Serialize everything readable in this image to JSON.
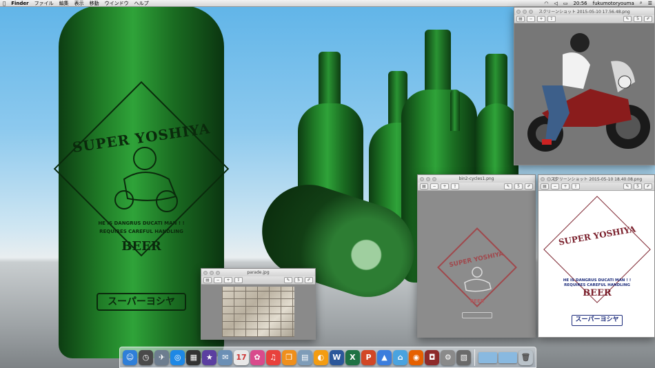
{
  "menubar": {
    "app_name": "Finder",
    "menus": [
      "ファイル",
      "編集",
      "表示",
      "移動",
      "ウインドウ",
      "ヘルプ"
    ],
    "clock": "20:56",
    "user": "fukumotoryouma"
  },
  "wallpaper": {
    "label_brand": "SUPER YOSHIYA",
    "label_line1": "HE IS DANGRUS DUCATI MAN ! !",
    "label_line2": "REQUIRES CAREFUL HANDLING",
    "label_beer": "BEER",
    "label_kana": "スーパーヨシヤ"
  },
  "windows": {
    "parade": {
      "title": "parade.jpg",
      "share_label": "5"
    },
    "screenshot1": {
      "title": "スクリーンショット 2015-05-10 17.56.48.png",
      "share_label": "5"
    },
    "bin2": {
      "title": "bin2-cycles1.png",
      "share_label": "5",
      "art_brand": "SUPER YOSHIYA",
      "art_beer": "BEER"
    },
    "screenshot2": {
      "title": "スクリーンショット 2015-05-10 18.40.08.png",
      "share_label": "5",
      "brand": "SUPER YOSHIYA",
      "line1": "HE IS DANGRUS DUCATI MAN ! !",
      "line2": "REQUIRES CAREFUL HANDLING",
      "beer": "BEER",
      "kana": "スーパーヨシヤ"
    }
  },
  "toolbar_icons": [
    "sidebar-toggle",
    "zoom-out",
    "zoom-in",
    "share",
    "markup",
    "rotate",
    "annotate"
  ],
  "dock": {
    "apps": [
      {
        "name": "finder",
        "glyph": "☺",
        "color": "#2f7fd8"
      },
      {
        "name": "dashboard",
        "glyph": "◷",
        "color": "#4a4a4a"
      },
      {
        "name": "launchpad",
        "glyph": "✈",
        "color": "#6d7d8f"
      },
      {
        "name": "safari",
        "glyph": "◎",
        "color": "#1e88e5"
      },
      {
        "name": "mission-control",
        "glyph": "▦",
        "color": "#333"
      },
      {
        "name": "imovie",
        "glyph": "★",
        "color": "#5b3fa0"
      },
      {
        "name": "mail",
        "glyph": "✉",
        "color": "#6b8fb5"
      },
      {
        "name": "calendar",
        "glyph": "17",
        "color": "#e8e8e8"
      },
      {
        "name": "photos",
        "glyph": "✿",
        "color": "#d94a8c"
      },
      {
        "name": "itunes",
        "glyph": "♫",
        "color": "#e8413c"
      },
      {
        "name": "ibooks",
        "glyph": "❒",
        "color": "#ef8f1c"
      },
      {
        "name": "preview",
        "glyph": "▤",
        "color": "#7e9cb8"
      },
      {
        "name": "flux",
        "glyph": "◐",
        "color": "#f39c12"
      },
      {
        "name": "word",
        "glyph": "W",
        "color": "#2b579a"
      },
      {
        "name": "excel",
        "glyph": "X",
        "color": "#1f7244"
      },
      {
        "name": "powerpoint",
        "glyph": "P",
        "color": "#d24726"
      },
      {
        "name": "keynote",
        "glyph": "▲",
        "color": "#3b7ddd"
      },
      {
        "name": "network",
        "glyph": "⌂",
        "color": "#4aa3df"
      },
      {
        "name": "firefox",
        "glyph": "◉",
        "color": "#e66000"
      },
      {
        "name": "photo-booth",
        "glyph": "◘",
        "color": "#8e2a2a"
      },
      {
        "name": "system-preferences",
        "glyph": "⚙",
        "color": "#8a8a8a"
      },
      {
        "name": "image-capture",
        "glyph": "▧",
        "color": "#6a6a6a"
      }
    ],
    "stacks": [
      {
        "name": "downloads-folder",
        "color": "#89b9e0"
      },
      {
        "name": "documents-folder",
        "color": "#89b9e0"
      }
    ],
    "trash_glyph": "🗑"
  }
}
